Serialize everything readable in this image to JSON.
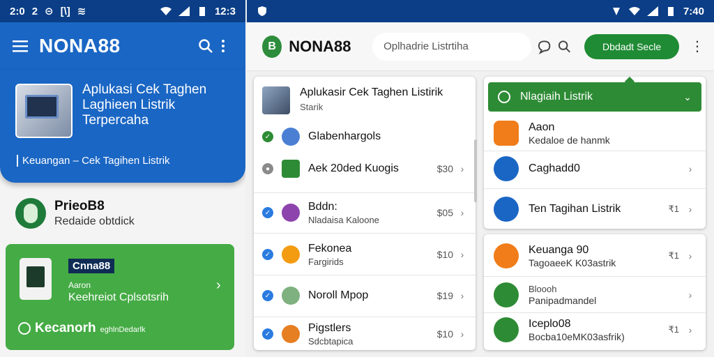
{
  "left": {
    "status": {
      "time": "2:0",
      "t2": "2",
      "t3": "⊝",
      "t4": "[\\]",
      "t5": "≋",
      "clock": "12:3"
    },
    "appbar": {
      "title": "NONA88"
    },
    "hero": {
      "title": "Aplukasi Cek Taghen Laghieen Listrik Terpercaha",
      "subtitle": "Keuangan – Cek Tagihen Listrik"
    },
    "brand": {
      "name": "PrieoB8",
      "subtitle": "Redaide obtdick"
    },
    "card": {
      "badge": "Cnna88",
      "label": "Aaron",
      "desc": "Keehreiot Cplsotsrih",
      "bottom_big": "Kecanorh",
      "bottom_small": "eghlnDedarlk"
    }
  },
  "right": {
    "status": {
      "clock": "7:40"
    },
    "appbar": {
      "logo_letter": "B",
      "title": "NONA88",
      "search_placeholder": "Oplhadrie Listrtiha",
      "primary_button": "Dbdadt Secle"
    },
    "list": {
      "title": "Aplukasir Cek Taghen Listirik",
      "subtitle": "Starik",
      "rows": [
        {
          "label": "Glabenhargols",
          "sub": "",
          "value": "",
          "check_color": "#2e8b35",
          "icon_color": "#4a7fd4"
        },
        {
          "label": "Aek 20ded Kuogis",
          "sub": "",
          "value": "$30",
          "check_color": "#8a8a8a",
          "icon_color": "#2e8b35"
        },
        {
          "label": "Bddn:",
          "sub": "Nladaisa Kaloone",
          "value": "$05",
          "check_color": "#2a7be0",
          "icon_color": "#8e44ad"
        },
        {
          "label": "Fekonea",
          "sub": "Fargirids",
          "value": "$10",
          "check_color": "#2a7be0",
          "icon_color": "#f39c12"
        },
        {
          "label": "Noroll Mpop",
          "sub": "",
          "value": "$19",
          "check_color": "#2a7be0",
          "icon_color": "#7fb07f"
        },
        {
          "label": "Pigstlers",
          "sub": "Sdcbtapica",
          "value": "$10",
          "check_color": "#2a7be0",
          "icon_color": "#e67e22"
        }
      ]
    },
    "dropdown": {
      "header": "Nlagiaih Listrik",
      "items": [
        {
          "label": "Aaon",
          "sub": "Kedaloe de hanmk",
          "value": "",
          "icon_color": "#f07d1a"
        },
        {
          "label": "Caghadd0",
          "sub": "",
          "value": "",
          "icon_color": "#1a66c4"
        },
        {
          "label": "Ten Tagihan Listrik",
          "sub": "",
          "value": "₹1",
          "icon_color": "#1a66c4"
        }
      ]
    },
    "bottom": {
      "items": [
        {
          "label": "Keuanga 90",
          "sub": "TagoaeeK K03astrik",
          "value": "₹1",
          "icon_color": "#f07d1a"
        },
        {
          "label": "Bloooh",
          "sub": "Panipadmandel",
          "value": "",
          "icon_color": "#2e8b35"
        },
        {
          "label": "Iceplo08",
          "sub": "Bocba10eMK03asfrik)",
          "value": "₹1",
          "icon_color": "#2e8b35"
        }
      ]
    }
  }
}
